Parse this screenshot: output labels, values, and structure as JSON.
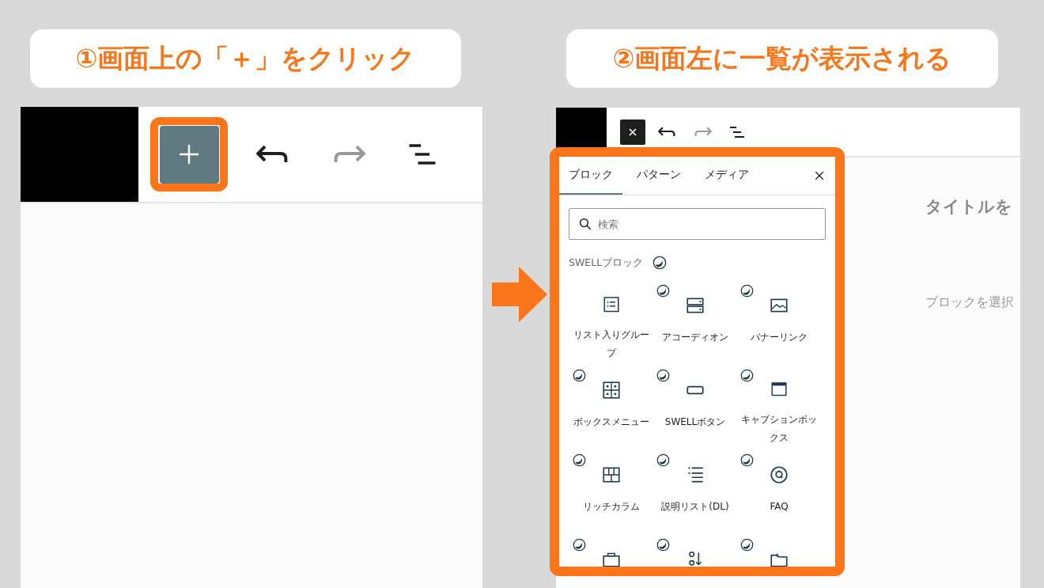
{
  "steps": [
    {
      "caption": "①画面上の「＋」をクリック"
    },
    {
      "caption": "②画面左に一覧が表示される"
    }
  ],
  "editor_before": {
    "toolbar": {
      "inserter_open": false,
      "highlighted": true
    }
  },
  "editor_after": {
    "toolbar": {
      "inserter_open": true
    },
    "title_field": {
      "placeholder": "タイトルを"
    },
    "hint": "ブロックを選択",
    "inserter": {
      "tabs": [
        {
          "label": "ブロック",
          "selected": true
        },
        {
          "label": "パターン",
          "selected": false
        },
        {
          "label": "メディア",
          "selected": false
        }
      ],
      "search": {
        "placeholder": "検索"
      },
      "section": "SWELLブロック",
      "blocks": [
        {
          "label": "リスト入りグループ",
          "badge": false
        },
        {
          "label": "アコーディオン",
          "badge": true
        },
        {
          "label": "バナーリンク",
          "badge": true
        },
        {
          "label": "ボックスメニュー",
          "badge": true
        },
        {
          "label": "SWELLボタン",
          "badge": true
        },
        {
          "label": "キャプションボックス",
          "badge": true
        },
        {
          "label": "リッチカラム",
          "badge": true
        },
        {
          "label": "説明リスト(DL)",
          "badge": true
        },
        {
          "label": "FAQ",
          "badge": true
        },
        {
          "badge": true
        },
        {
          "badge": true
        },
        {
          "badge": true
        }
      ]
    }
  }
}
